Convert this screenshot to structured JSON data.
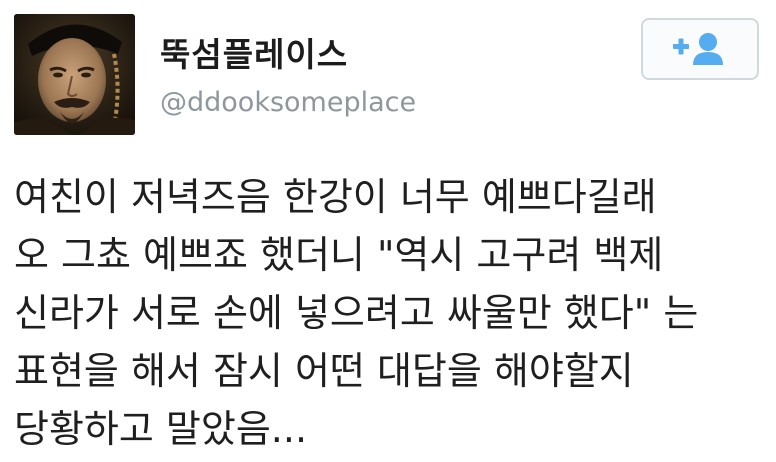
{
  "profile": {
    "display_name": "뚝섬플레이스",
    "handle": "@ddooksomeplace",
    "avatar_icon": "profile-photo",
    "follow_icon": "add-user-icon",
    "follow_icon_color": "#55acee"
  },
  "tweet": {
    "lines": [
      "여친이 저녁즈음 한강이 너무 예쁘다길래",
      "오 그쵸 예쁘죠 했더니 \"역시 고구려 백제",
      "신라가 서로 손에 넣으려고 싸울만 했다\" 는",
      "표현을 해서 잠시 어떤 대답을 해야할지",
      "당황하고 말았음..."
    ]
  }
}
